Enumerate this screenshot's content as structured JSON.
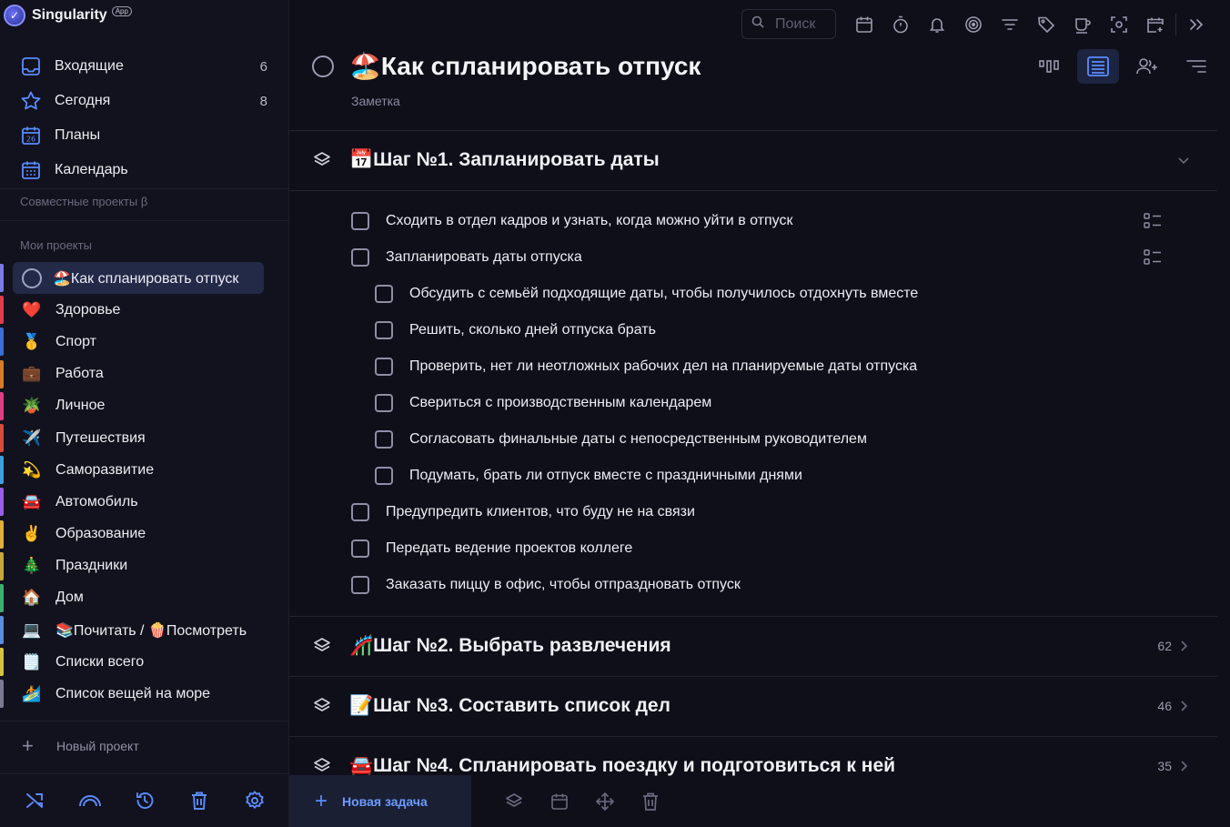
{
  "app": {
    "name": "Singularity",
    "badge": "App"
  },
  "sidebar": {
    "nav": [
      {
        "label": "Входящие",
        "count": "6",
        "icon": "inbox-icon"
      },
      {
        "label": "Сегодня",
        "count": "8",
        "icon": "star-icon"
      },
      {
        "label": "Планы",
        "count": "",
        "icon": "calendar-day-icon"
      },
      {
        "label": "Календарь",
        "count": "",
        "icon": "calendar-grid-icon"
      }
    ],
    "shared_label": "Совместные проекты β",
    "my_label": "Мои проекты",
    "projects": [
      {
        "emoji": "",
        "name": "🏖️Как спланировать отпуск",
        "color": "#7a7ae6",
        "active": true
      },
      {
        "emoji": "❤️",
        "name": "Здоровье",
        "color": "#e23d4b"
      },
      {
        "emoji": "🥇",
        "name": "Спорт",
        "color": "#3a6fd8"
      },
      {
        "emoji": "💼",
        "name": "Работа",
        "color": "#d67b2a"
      },
      {
        "emoji": "🪴",
        "name": "Личное",
        "color": "#e03d84"
      },
      {
        "emoji": "✈️",
        "name": "Путешествия",
        "color": "#d64b3b"
      },
      {
        "emoji": "💫",
        "name": "Саморазвитие",
        "color": "#3aa0e0"
      },
      {
        "emoji": "🚘",
        "name": "Автомобиль",
        "color": "#9b5de5"
      },
      {
        "emoji": "✌️",
        "name": "Образование",
        "color": "#e0b03a"
      },
      {
        "emoji": "🎄",
        "name": "Праздники",
        "color": "#c8a83a"
      },
      {
        "emoji": "🏠",
        "name": "Дом",
        "color": "#3ab070"
      },
      {
        "emoji": "💻",
        "name": "📚Почитать / 🍿Посмотреть",
        "color": "#5a8ce0"
      },
      {
        "emoji": "🗒️",
        "name": "Списки всего",
        "color": "#d8c040"
      },
      {
        "emoji": "🏄",
        "name": "Список вещей на море",
        "color": "#7a7a90"
      }
    ],
    "new_project": "Новый проект"
  },
  "toolbar": {
    "search_placeholder": "Поиск",
    "icons": [
      "calendar-icon",
      "timer-icon",
      "bell-icon",
      "focus-icon",
      "filter-icon",
      "tag-icon",
      "mug-icon",
      "scan-icon",
      "calendar-add-icon",
      "expand-icon"
    ]
  },
  "header": {
    "title": "🏖️Как спланировать отпуск",
    "subtitle": "Заметка"
  },
  "sections": [
    {
      "title": "📅Шаг №1. Запланировать даты",
      "expanded": true,
      "count": "",
      "tasks": [
        {
          "label": "Сходить в отдел кадров и узнать, когда можно уйти в отпуск",
          "level": 0,
          "has_subtasks": true
        },
        {
          "label": "Запланировать даты отпуска",
          "level": 0,
          "has_subtasks": true
        },
        {
          "label": "Обсудить с семьёй подходящие даты, чтобы получилось отдохнуть вместе",
          "level": 1
        },
        {
          "label": "Решить, сколько дней отпуска брать",
          "level": 1
        },
        {
          "label": "Проверить, нет ли неотложных рабочих дел на планируемые даты отпуска",
          "level": 1
        },
        {
          "label": "Свериться с производственным календарем",
          "level": 1
        },
        {
          "label": "Согласовать финальные даты с непосредственным руководителем",
          "level": 1
        },
        {
          "label": "Подумать, брать ли отпуск вместе с праздничными днями",
          "level": 1
        },
        {
          "label": "Предупредить клиентов, что буду не на связи",
          "level": 0
        },
        {
          "label": "Передать ведение проектов коллеге",
          "level": 0
        },
        {
          "label": "Заказать пиццу в офис, чтобы отпраздновать отпуск",
          "level": 0
        }
      ]
    },
    {
      "title": "🎢Шаг №2. Выбрать развлечения",
      "expanded": false,
      "count": "62"
    },
    {
      "title": "📝Шаг №3. Составить список дел",
      "expanded": false,
      "count": "46"
    },
    {
      "title": "🚘Шаг №4. Спланировать поездку и подготовиться к ней",
      "expanded": false,
      "count": "35"
    }
  ],
  "bottom_bar": {
    "new_task": "Новая задача"
  },
  "colors": {
    "accent": "#5a8cff",
    "background": "#0f0f19"
  }
}
